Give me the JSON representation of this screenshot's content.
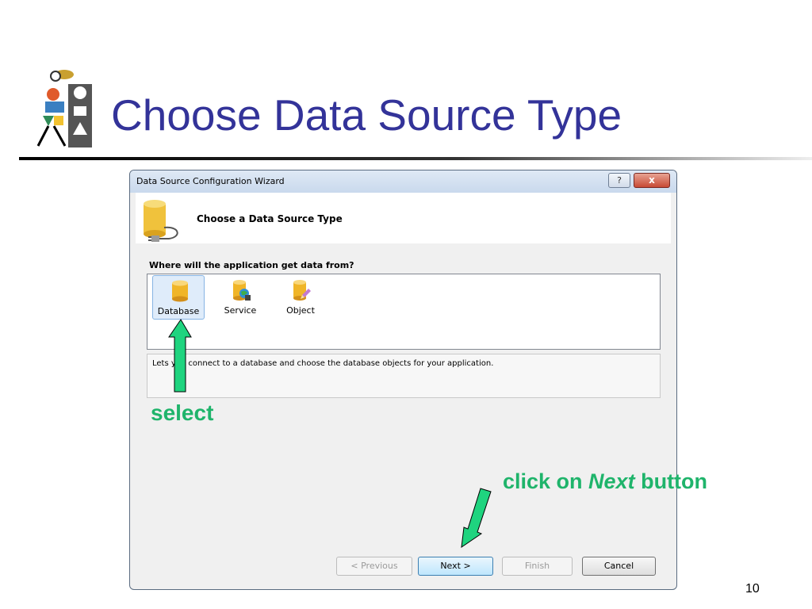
{
  "slide": {
    "title": "Choose Data Source Type",
    "page_number": "10"
  },
  "dialog": {
    "window_title": "Data Source Configuration Wizard",
    "help_button": "?",
    "close_button": "x",
    "header_title": "Choose a Data Source Type",
    "question": "Where will the application get data from?",
    "types": [
      {
        "label": "Database",
        "icon": "database-icon",
        "selected": true
      },
      {
        "label": "Service",
        "icon": "service-icon",
        "selected": false
      },
      {
        "label": "Object",
        "icon": "object-icon",
        "selected": false
      }
    ],
    "description": "Lets you connect to a database and choose the database objects for your application.",
    "buttons": {
      "previous": "< Previous",
      "next": "Next >",
      "finish": "Finish",
      "cancel": "Cancel"
    }
  },
  "annotations": {
    "select": "select",
    "next_prefix": "click on ",
    "next_word": "Next",
    "next_suffix": " button",
    "color": "#1fb46b"
  },
  "colors": {
    "title": "#333399",
    "selected_item_bg": "#dfecfa"
  }
}
